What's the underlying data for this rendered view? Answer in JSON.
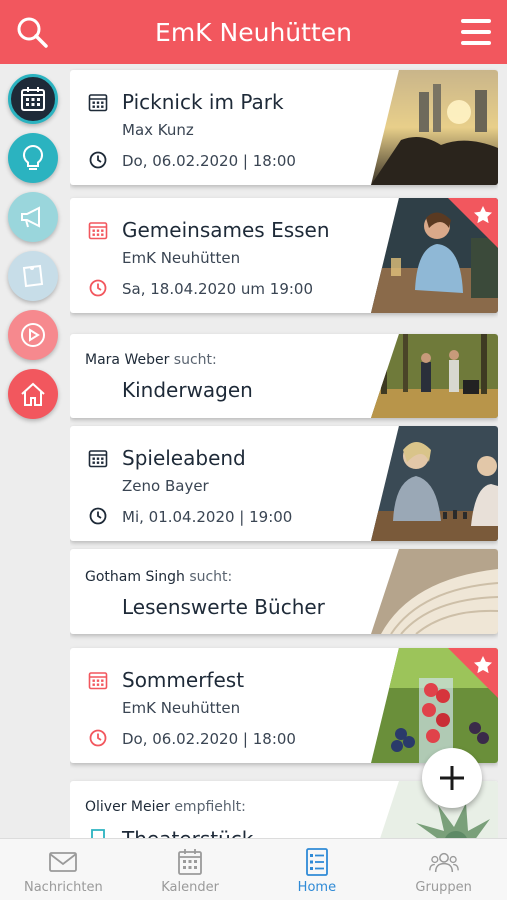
{
  "header": {
    "title": "EmK Neuhütten",
    "search_icon": "search-icon",
    "menu_icon": "hamburger-menu-icon"
  },
  "sidebar": [
    {
      "icon": "calendar-icon",
      "color": "#1e2a38"
    },
    {
      "icon": "lightbulb-icon",
      "color": "#2bb3c0"
    },
    {
      "icon": "megaphone-icon",
      "color": "#9ad6dc"
    },
    {
      "icon": "pinned-note-icon",
      "color": "#c7dde8"
    },
    {
      "icon": "play-icon",
      "color": "#f6898e"
    },
    {
      "icon": "home-icon",
      "color": "#f2575e"
    }
  ],
  "feed": [
    {
      "type": "event",
      "title": "Picknick im Park",
      "host": "Max Kunz",
      "date": "Do, 06.02.2020 | 18:00",
      "accent": "#1e2a38",
      "favorite": false
    },
    {
      "type": "event",
      "title": "Gemeinsames Essen",
      "host": "EmK Neuhütten",
      "date": "Sa, 18.04.2020 um 19:00",
      "accent": "#f2575e",
      "favorite": true
    },
    {
      "type": "search",
      "person": "Mara Weber",
      "verb": "sucht:",
      "item": "Kinderwagen"
    },
    {
      "type": "event",
      "title": "Spieleabend",
      "host": "Zeno Bayer",
      "date": "Mi, 01.04.2020 | 19:00",
      "accent": "#1e2a38",
      "favorite": false
    },
    {
      "type": "search",
      "person": "Gotham Singh",
      "verb": "sucht:",
      "item": "Lesenswerte Bücher"
    },
    {
      "type": "event",
      "title": "Sommerfest",
      "host": "EmK Neuhütten",
      "date": "Do, 06.02.2020 | 18:00",
      "accent": "#f2575e",
      "favorite": true
    },
    {
      "type": "recommend",
      "person": "Oliver Meier",
      "verb": "empfiehlt:",
      "item": "Theaterstück"
    }
  ],
  "fab": {
    "icon": "plus-icon"
  },
  "bottom_nav": [
    {
      "label": "Nachrichten",
      "icon": "mail-icon",
      "active": false
    },
    {
      "label": "Kalender",
      "icon": "calendar-icon",
      "active": false
    },
    {
      "label": "Home",
      "icon": "list-icon",
      "active": true
    },
    {
      "label": "Gruppen",
      "icon": "group-icon",
      "active": false
    }
  ],
  "colors": {
    "brand": "#f2575e",
    "active_tab": "#2f8ad6",
    "dark": "#1e2a38"
  }
}
